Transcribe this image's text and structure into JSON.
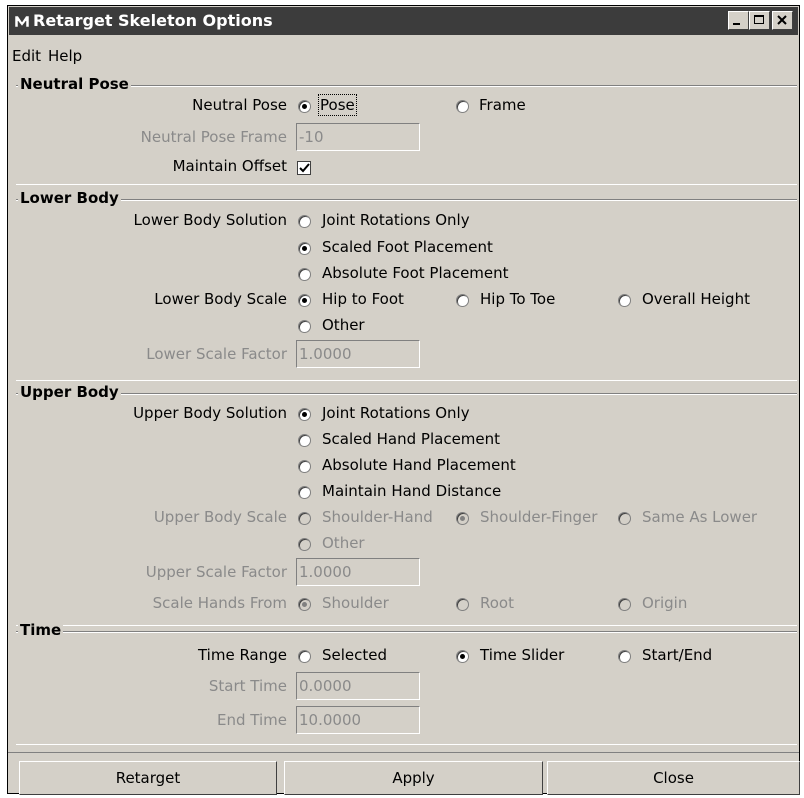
{
  "window": {
    "title": "Retarget Skeleton Options"
  },
  "menu": [
    "Edit",
    "Help"
  ],
  "neutral_pose": {
    "section_title": "Neutral Pose",
    "pose_label": "Neutral Pose",
    "pose_options": [
      "Pose",
      "Frame"
    ],
    "pose_selected": "Pose",
    "frame_label": "Neutral Pose Frame",
    "frame_value": "-10",
    "offset_label": "Maintain Offset",
    "offset_checked": true
  },
  "lower_body": {
    "section_title": "Lower Body",
    "solution_label": "Lower Body Solution",
    "solution_options": [
      "Joint Rotations Only",
      "Scaled Foot Placement",
      "Absolute Foot Placement"
    ],
    "solution_selected": "Scaled Foot Placement",
    "scale_label": "Lower Body Scale",
    "scale_options": [
      "Hip to Foot",
      "Hip To Toe",
      "Overall Height",
      "Other"
    ],
    "scale_selected": "Hip to Foot",
    "factor_label": "Lower Scale Factor",
    "factor_value": "1.0000"
  },
  "upper_body": {
    "section_title": "Upper Body",
    "solution_label": "Upper Body Solution",
    "solution_options": [
      "Joint Rotations Only",
      "Scaled Hand Placement",
      "Absolute Hand Placement",
      "Maintain Hand Distance"
    ],
    "solution_selected": "Joint Rotations Only",
    "scale_label": "Upper Body Scale",
    "scale_options": [
      "Shoulder-Hand",
      "Shoulder-Finger",
      "Same As Lower",
      "Other"
    ],
    "scale_selected": "Shoulder-Finger",
    "factor_label": "Upper Scale Factor",
    "factor_value": "1.0000",
    "hands_from_label": "Scale Hands From",
    "hands_from_options": [
      "Shoulder",
      "Root",
      "Origin"
    ],
    "hands_from_selected": "Shoulder"
  },
  "time": {
    "section_title": "Time",
    "range_label": "Time Range",
    "range_options": [
      "Selected",
      "Time Slider",
      "Start/End"
    ],
    "range_selected": "Time Slider",
    "start_label": "Start Time",
    "start_value": "0.0000",
    "end_label": "End Time",
    "end_value": "10.0000"
  },
  "buttons": {
    "retarget": "Retarget",
    "apply": "Apply",
    "close": "Close"
  }
}
